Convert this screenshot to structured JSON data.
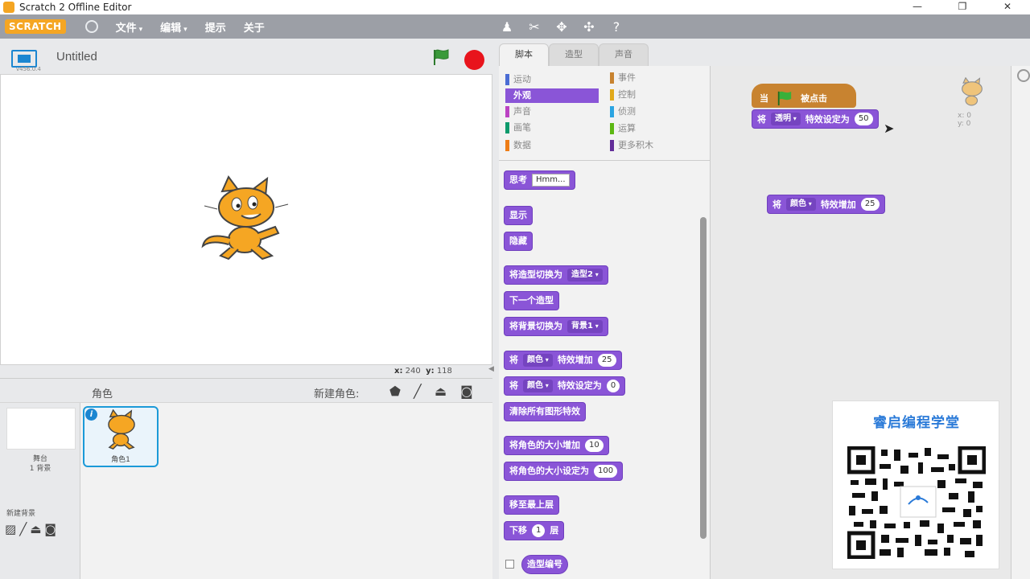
{
  "window": {
    "title": "Scratch 2 Offline Editor",
    "controls": [
      "—",
      "❐",
      "✕"
    ]
  },
  "menubar": {
    "logo": "SCRATCH",
    "items": [
      {
        "label": "文件",
        "caret": "▾"
      },
      {
        "label": "编辑",
        "caret": "▾"
      },
      {
        "label": "提示",
        "caret": ""
      },
      {
        "label": "关于",
        "caret": ""
      }
    ]
  },
  "stage": {
    "project_title": "Untitled",
    "version": "v456.0.4",
    "coords": {
      "x_label": "x:",
      "x": "240",
      "y_label": "y:",
      "y": "118"
    }
  },
  "sprite_panel": {
    "header": "角色",
    "new_sprite_label": "新建角色:",
    "stage_label_1": "舞台",
    "stage_label_2": "1 背景",
    "new_backdrop_label": "新建背景",
    "sprites": [
      {
        "name": "角色1"
      }
    ]
  },
  "tabs": [
    {
      "label": "脚本",
      "active": true
    },
    {
      "label": "造型",
      "active": false
    },
    {
      "label": "声音",
      "active": false
    }
  ],
  "categories": {
    "left": [
      {
        "label": "运动",
        "color": "#4a6cd4"
      },
      {
        "label": "外观",
        "color": "#8a55d7",
        "selected": true
      },
      {
        "label": "声音",
        "color": "#bb42c3"
      },
      {
        "label": "画笔",
        "color": "#0e9a6c"
      },
      {
        "label": "数据",
        "color": "#ee7d16"
      }
    ],
    "right": [
      {
        "label": "事件",
        "color": "#c88330"
      },
      {
        "label": "控制",
        "color": "#e1a91a"
      },
      {
        "label": "侦测",
        "color": "#2ca5e2"
      },
      {
        "label": "运算",
        "color": "#5cb712"
      },
      {
        "label": "更多积木",
        "color": "#632d99"
      }
    ]
  },
  "palette_blocks": {
    "think": {
      "label": "思考",
      "value": "Hmm..."
    },
    "show": "显示",
    "hide": "隐藏",
    "switch_costume": {
      "label": "将造型切换为",
      "value": "造型2"
    },
    "next_costume": "下一个造型",
    "switch_backdrop": {
      "label": "将背景切换为",
      "value": "背景1"
    },
    "change_effect": {
      "label_pre": "将",
      "effect": "颜色",
      "label_post": "特效增加",
      "value": "25"
    },
    "set_effect": {
      "label_pre": "将",
      "effect": "颜色",
      "label_post": "特效设定为",
      "value": "0"
    },
    "clear_effects": "清除所有图形特效",
    "change_size": {
      "label": "将角色的大小增加",
      "value": "10"
    },
    "set_size": {
      "label": "将角色的大小设定为",
      "value": "100"
    },
    "go_front": "移至最上层",
    "go_back": {
      "label_pre": "下移",
      "value": "1",
      "label_post": "层"
    },
    "costume_num": "造型编号"
  },
  "script": {
    "hat": {
      "label_pre": "当",
      "label_post": "被点击"
    },
    "set_effect": {
      "label_pre": "将",
      "effect": "透明",
      "label_post": "特效设定为",
      "value": "50"
    },
    "change_effect": {
      "label_pre": "将",
      "effect": "颜色",
      "label_post": "特效增加",
      "value": "25"
    },
    "sprite_x": "x: 0",
    "sprite_y": "y: 0"
  },
  "qr_card": {
    "title": "睿启编程学堂"
  },
  "colors": {
    "looks": "#8a55d7",
    "events": "#c88330",
    "menubar": "#9c9fa6",
    "accent": "#1b86d1"
  }
}
